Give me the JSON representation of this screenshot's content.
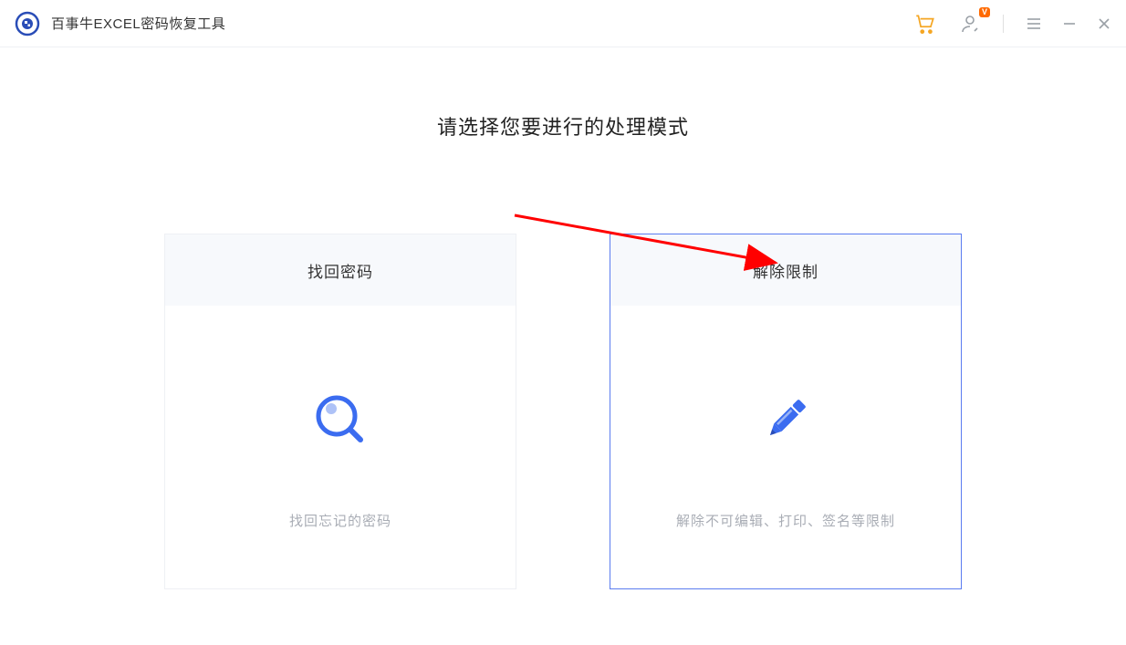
{
  "app": {
    "title": "百事牛EXCEL密码恢复工具",
    "account_badge": "V"
  },
  "main": {
    "heading": "请选择您要进行的处理模式"
  },
  "cards": {
    "recover": {
      "title": "找回密码",
      "desc": "找回忘记的密码"
    },
    "unlock": {
      "title": "解除限制",
      "desc": "解除不可编辑、打印、签名等限制"
    }
  }
}
